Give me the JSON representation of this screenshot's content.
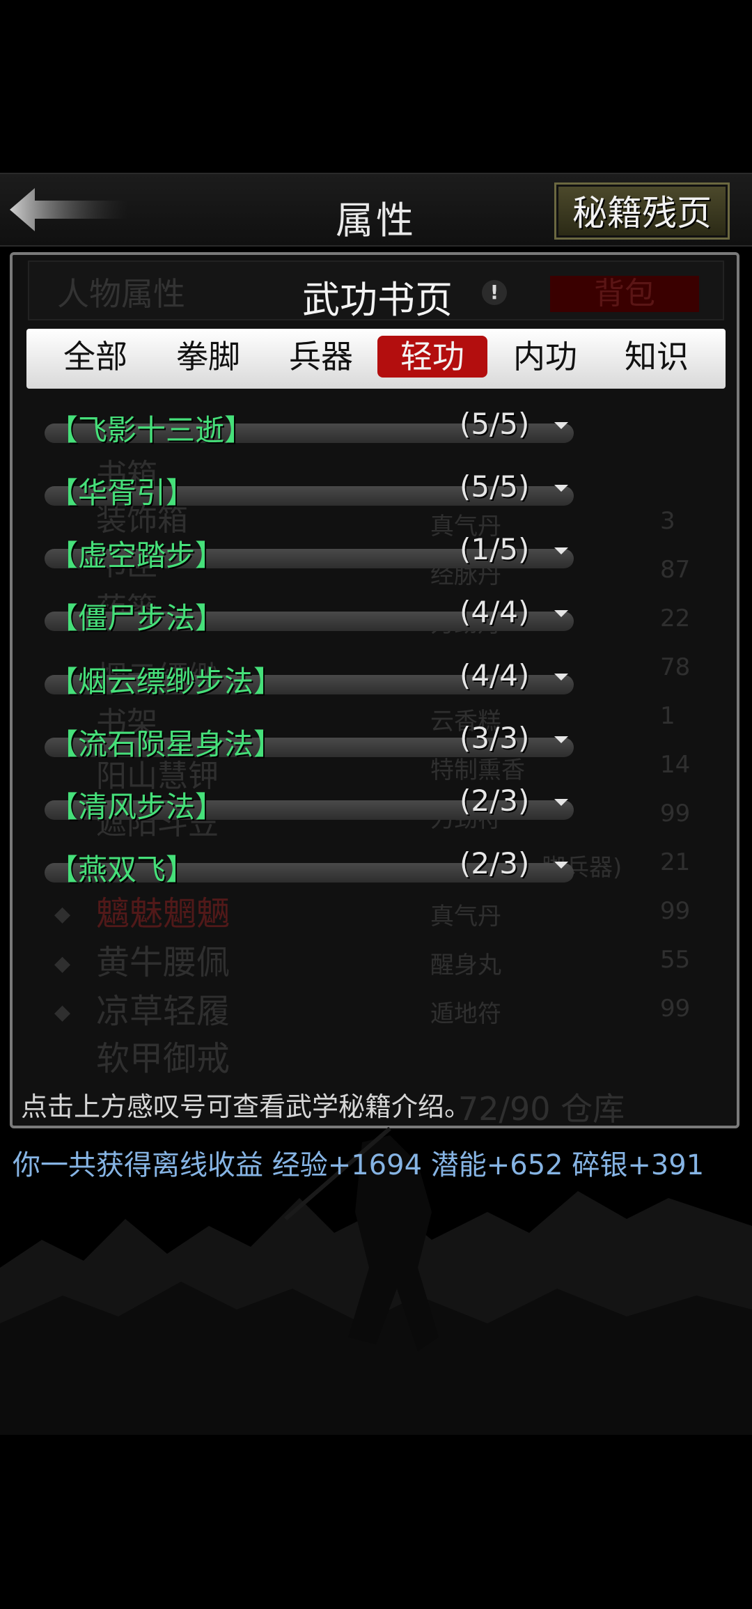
{
  "header": {
    "title": "属性",
    "secret_button": "秘籍残页"
  },
  "subheader": {
    "left_tab": "人物属性",
    "title": "武功书页",
    "info_mark": "!",
    "right_tab": "背包"
  },
  "filters": [
    {
      "label": "全部",
      "active": false
    },
    {
      "label": "拳脚",
      "active": false
    },
    {
      "label": "兵器",
      "active": false
    },
    {
      "label": "轻功",
      "active": true
    },
    {
      "label": "内功",
      "active": false
    },
    {
      "label": "知识",
      "active": false
    }
  ],
  "skills": [
    {
      "name": "【飞影十三逝】",
      "count": "(5/5)"
    },
    {
      "name": "【华胥引】",
      "count": "(5/5)"
    },
    {
      "name": "【虚空踏步】",
      "count": "(1/5)"
    },
    {
      "name": "【僵尸步法】",
      "count": "(4/4)"
    },
    {
      "name": "【烟云缥缈步法】",
      "count": "(4/4)"
    },
    {
      "name": "【流石陨星身法】",
      "count": "(3/3)"
    },
    {
      "name": "【清风步法】",
      "count": "(2/3)"
    },
    {
      "name": "【燕双飞】",
      "count": "(2/3)"
    }
  ],
  "background_inventory": {
    "left_items": [
      "书箱",
      "装饰箱",
      "书匣",
      "药篓",
      "烟云缥缈",
      "书架",
      "阳山慧钾",
      "遮阳斗笠",
      "魑魅魍魉",
      "黄牛腰佩",
      "凉草轻履",
      "软甲御戒"
    ],
    "right_items": [
      {
        "name": "真气丹",
        "qty": "3"
      },
      {
        "name": "经脉丹",
        "qty": "87"
      },
      {
        "name": "力劲丹",
        "qty": "22"
      },
      {
        "name": "",
        "qty": "78"
      },
      {
        "name": "云香糕",
        "qty": "1"
      },
      {
        "name": "特制熏香",
        "qty": "14"
      },
      {
        "name": "力劲符",
        "qty": "99"
      },
      {
        "name": "脚兵器)",
        "qty": "21"
      },
      {
        "name": "真气丹",
        "qty": "99"
      },
      {
        "name": "醒身丸",
        "qty": "55"
      },
      {
        "name": "遁地符",
        "qty": "99"
      }
    ],
    "capacity": "72/90 仓库"
  },
  "hint_text": "点击上方感叹号可查看武学秘籍介绍。",
  "offline_message": "你一共获得离线收益 经验+1694 潜能+652 碎银+391",
  "colors": {
    "skill_name": "#46e07a",
    "active_tab": "#b30e0e",
    "message": "#86b4e4"
  }
}
